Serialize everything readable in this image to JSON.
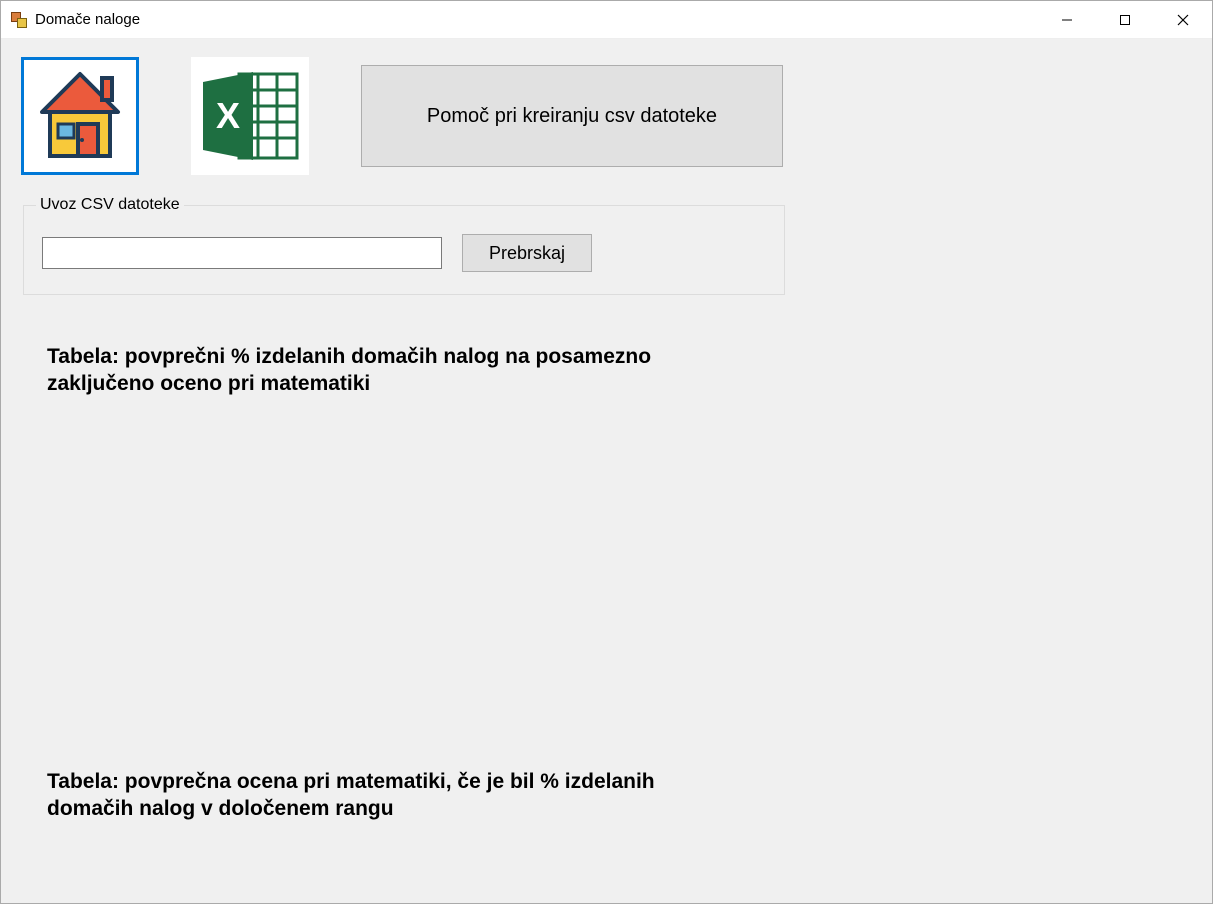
{
  "window": {
    "title": "Domače naloge"
  },
  "toolbar": {
    "help_label": "Pomoč pri kreiranju csv datoteke"
  },
  "import_group": {
    "legend": "Uvoz CSV datoteke",
    "file_value": "",
    "browse_label": "Prebrskaj"
  },
  "section1_heading": "Tabela: povprečni % izdelanih domačih nalog na posamezno zaključeno oceno pri matematiki",
  "section2_heading": "Tabela: povprečna ocena pri matematiki, če je bil % izdelanih domačih nalog v določenem rangu"
}
